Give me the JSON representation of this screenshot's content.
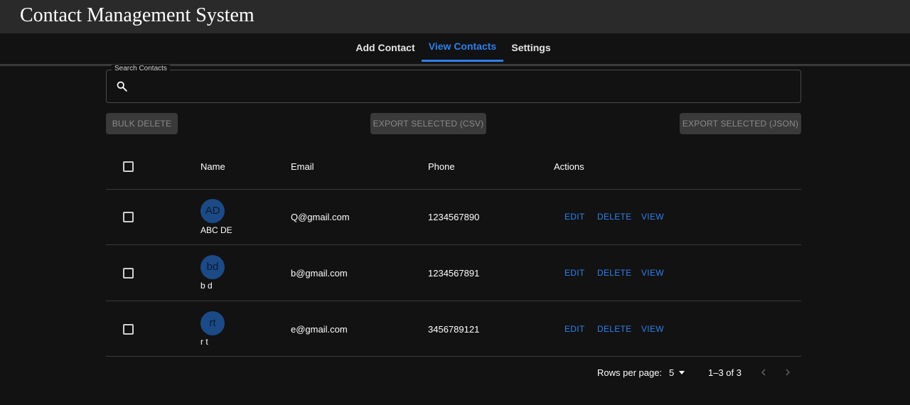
{
  "app": {
    "title": "Contact Management System"
  },
  "tabs": [
    {
      "label": "Add Contact",
      "active": false
    },
    {
      "label": "View Contacts",
      "active": true
    },
    {
      "label": "Settings",
      "active": false
    }
  ],
  "search": {
    "label": "Search Contacts",
    "value": "",
    "placeholder": ""
  },
  "toolbar": {
    "bulk_delete": "BULK DELETE",
    "export_csv": "EXPORT SELECTED (CSV)",
    "export_json": "EXPORT SELECTED (JSON)"
  },
  "table": {
    "headers": {
      "name": "Name",
      "email": "Email",
      "phone": "Phone",
      "actions": "Actions"
    },
    "rows": [
      {
        "initials": "AD",
        "name": "ABC DE",
        "email": "Q@gmail.com",
        "phone": "1234567890"
      },
      {
        "initials": "bd",
        "name": "b d",
        "email": "b@gmail.com",
        "phone": "1234567891"
      },
      {
        "initials": "rt",
        "name": "r t",
        "email": "e@gmail.com",
        "phone": "3456789121"
      }
    ],
    "actions": {
      "edit": "EDIT",
      "delete": "DELETE",
      "view": "VIEW"
    }
  },
  "pagination": {
    "rows_per_page_label": "Rows per page:",
    "rows_per_page": "5",
    "range": "1–3 of 3"
  },
  "colors": {
    "accent": "#2f80ed",
    "avatar": "#1c4a86",
    "background": "#121212",
    "appbar": "#2a2a2a"
  },
  "icons": {
    "search": "search-icon",
    "dropdown": "caret-down-icon",
    "prev": "chevron-left-icon",
    "next": "chevron-right-icon"
  }
}
